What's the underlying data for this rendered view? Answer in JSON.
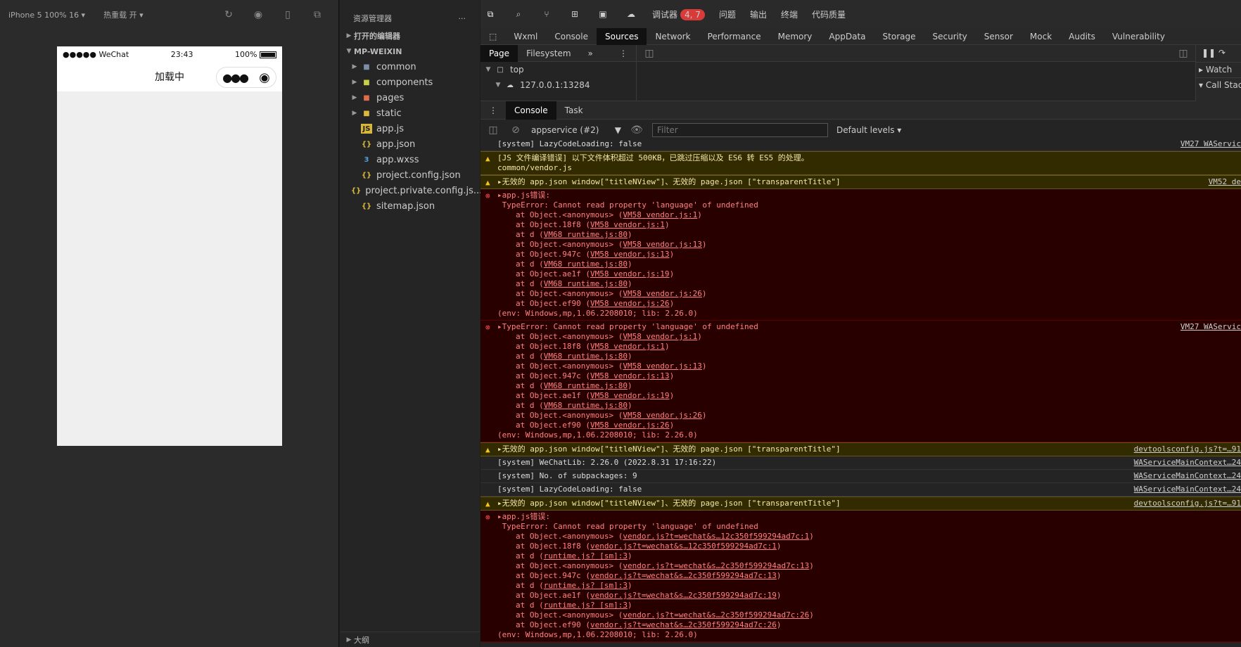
{
  "simulator": {
    "device_label": "iPhone 5 100% 16 ▾",
    "hot_reload_label": "热重载 开 ▾",
    "phone": {
      "carrier": "●●●●● WeChat",
      "time": "23:43",
      "battery": "100%",
      "nav_title": "加载中"
    }
  },
  "explorer": {
    "title": "资源管理器",
    "more": "···",
    "open_editors": "打开的编辑器",
    "project": "MP-WEIXIN",
    "outline": "大纲",
    "folders": [
      "common",
      "components",
      "pages",
      "static"
    ],
    "files": [
      "app.js",
      "app.json",
      "app.wxss",
      "project.config.json",
      "project.private.config.js...",
      "sitemap.json"
    ]
  },
  "devtools": {
    "top_tabs": [
      "调试器",
      "问题",
      "输出",
      "终端",
      "代码质量"
    ],
    "top_badge": "4, 7",
    "panel_tabs": [
      "Wxml",
      "Console",
      "Sources",
      "Network",
      "Performance",
      "Memory",
      "AppData",
      "Storage",
      "Security",
      "Sensor",
      "Mock",
      "Audits",
      "Vulnerability"
    ],
    "sources_tabs": [
      "Page",
      "Filesystem"
    ],
    "tree_top": "top",
    "tree_host": "127.0.0.1:13284",
    "side_watch": "Watch",
    "side_callstack": "Call Stack",
    "console_tabs": [
      "Console",
      "Task"
    ],
    "context": "appservice (#2)",
    "filter_placeholder": "Filter",
    "levels": "Default levels ▾"
  },
  "console": {
    "rows": [
      {
        "type": "info",
        "text": "[system] LazyCodeLoading: false",
        "src": "VM27 WAServic"
      },
      {
        "type": "warn",
        "text": "[JS 文件编译错误] 以下文件体积超过 500KB，已跳过压缩以及 ES6 转 ES5 的处理。\ncommon/vendor.js",
        "src": ""
      },
      {
        "type": "warn",
        "text": "▸无效的 app.json window[\"titleNView\"]、无效的 page.json [\"transparentTitle\"]",
        "src": "VM52 de"
      },
      {
        "type": "err",
        "text": "▸app.js错误:\n TypeError: Cannot read property 'language' of undefined",
        "src": "",
        "env": "(env: Windows,mp,1.06.2208010; lib: 2.26.0)",
        "stack": [
          [
            "at Object.<anonymous> (",
            "VM58 vendor.js:1",
            ")"
          ],
          [
            "at Object.18f8 (",
            "VM58 vendor.js:1",
            ")"
          ],
          [
            "at d (",
            "VM68 runtime.js:80",
            ")"
          ],
          [
            "at Object.<anonymous> (",
            "VM58 vendor.js:13",
            ")"
          ],
          [
            "at Object.947c (",
            "VM58 vendor.js:13",
            ")"
          ],
          [
            "at d (",
            "VM68 runtime.js:80",
            ")"
          ],
          [
            "at Object.ae1f (",
            "VM58 vendor.js:19",
            ")"
          ],
          [
            "at d (",
            "VM68 runtime.js:80",
            ")"
          ],
          [
            "at Object.<anonymous> (",
            "VM58 vendor.js:26",
            ")"
          ],
          [
            "at Object.ef90 (",
            "VM58 vendor.js:26",
            ")"
          ]
        ]
      },
      {
        "type": "err",
        "text": "▸TypeError: Cannot read property 'language' of undefined",
        "src": "VM27 WAServic",
        "env": "(env: Windows,mp,1.06.2208010; lib: 2.26.0)",
        "stack": [
          [
            "at Object.<anonymous> (",
            "VM58 vendor.js:1",
            ")"
          ],
          [
            "at Object.18f8 (",
            "VM58 vendor.js:1",
            ")"
          ],
          [
            "at d (",
            "VM68 runtime.js:80",
            ")"
          ],
          [
            "at Object.<anonymous> (",
            "VM58 vendor.js:13",
            ")"
          ],
          [
            "at Object.947c (",
            "VM58 vendor.js:13",
            ")"
          ],
          [
            "at d (",
            "VM68 runtime.js:80",
            ")"
          ],
          [
            "at Object.ae1f (",
            "VM58 vendor.js:19",
            ")"
          ],
          [
            "at d (",
            "VM68 runtime.js:80",
            ")"
          ],
          [
            "at Object.<anonymous> (",
            "VM58 vendor.js:26",
            ")"
          ],
          [
            "at Object.ef90 (",
            "VM58 vendor.js:26",
            ")"
          ]
        ]
      },
      {
        "type": "warn",
        "text": "▸无效的 app.json window[\"titleNView\"]、无效的 page.json [\"transparentTitle\"]",
        "src": "devtoolsconfig.js?t=…91"
      },
      {
        "type": "info",
        "text": "[system] WeChatLib: 2.26.0 (2022.8.31 17:16:22)",
        "src": "WAServiceMainContext…24"
      },
      {
        "type": "info",
        "text": "[system] No. of subpackages: 9",
        "src": "WAServiceMainContext…24"
      },
      {
        "type": "info",
        "text": "[system] LazyCodeLoading: false",
        "src": "WAServiceMainContext…24"
      },
      {
        "type": "warn",
        "text": "▸无效的 app.json window[\"titleNView\"]、无效的 page.json [\"transparentTitle\"]",
        "src": "devtoolsconfig.js?t=…91"
      },
      {
        "type": "err",
        "text": "▸app.js错误:\n TypeError: Cannot read property 'language' of undefined",
        "src": "",
        "env": "(env: Windows,mp,1.06.2208010; lib: 2.26.0)",
        "stack": [
          [
            "at Object.<anonymous> (",
            "vendor.js?t=wechat&s…12c350f599294ad7c:1",
            ")"
          ],
          [
            "at Object.18f8 (",
            "vendor.js?t=wechat&s…12c350f599294ad7c:1",
            ")"
          ],
          [
            "at d (",
            "runtime.js? [sm]:3",
            ")"
          ],
          [
            "at Object.<anonymous> (",
            "vendor.js?t=wechat&s…2c350f599294ad7c:13",
            ")"
          ],
          [
            "at Object.947c (",
            "vendor.js?t=wechat&s…2c350f599294ad7c:13",
            ")"
          ],
          [
            "at d (",
            "runtime.js? [sm]:3",
            ")"
          ],
          [
            "at Object.ae1f (",
            "vendor.js?t=wechat&s…2c350f599294ad7c:19",
            ")"
          ],
          [
            "at d (",
            "runtime.js? [sm]:3",
            ")"
          ],
          [
            "at Object.<anonymous> (",
            "vendor.js?t=wechat&s…2c350f599294ad7c:26",
            ")"
          ],
          [
            "at Object.ef90 (",
            "vendor.js?t=wechat&s…2c350f599294ad7c:26",
            ")"
          ]
        ]
      }
    ]
  }
}
